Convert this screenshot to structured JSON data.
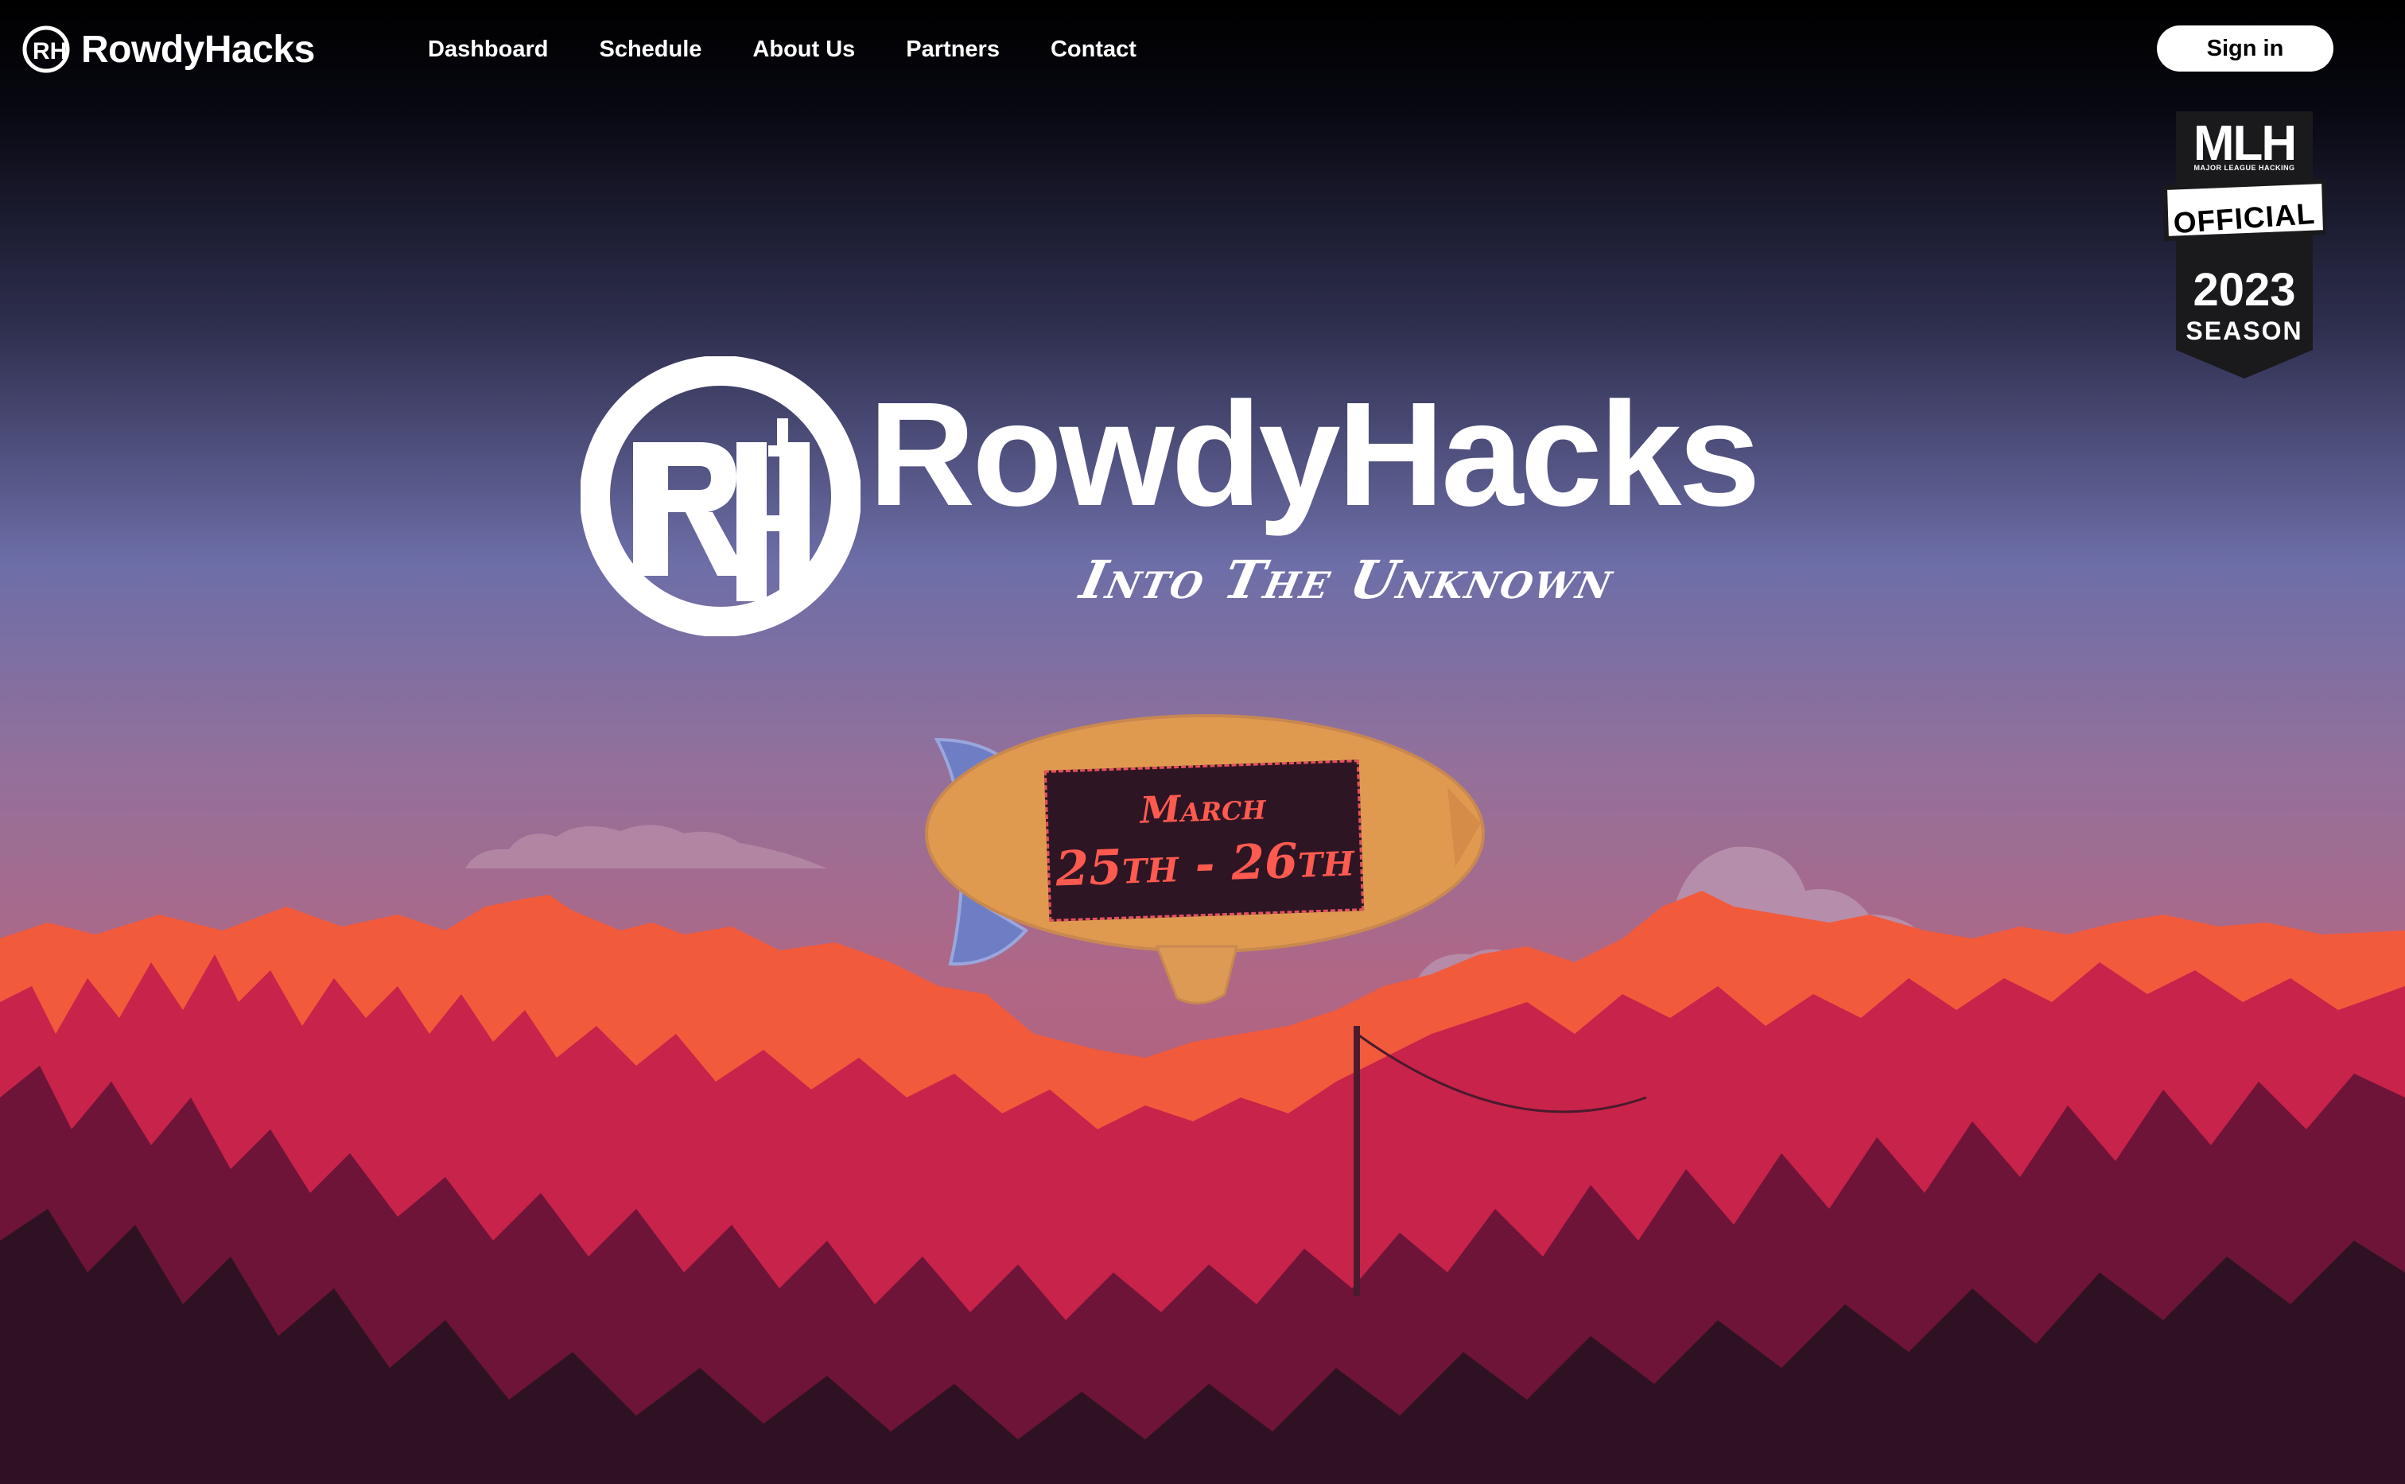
{
  "brand": {
    "name": "RowdyHacks"
  },
  "nav": {
    "links": [
      {
        "label": "Dashboard"
      },
      {
        "label": "Schedule"
      },
      {
        "label": "About Us"
      },
      {
        "label": "Partners"
      },
      {
        "label": "Contact"
      }
    ],
    "signin_label": "Sign in"
  },
  "mlh_badge": {
    "logo": "MLH",
    "subtitle": "MAJOR LEAGUE HACKING",
    "official": "OFFICIAL",
    "year": "2023",
    "season": "SEASON"
  },
  "hero": {
    "title": "RowdyHacks",
    "tagline": "Into The Unknown",
    "logo_icon": "rh-monogram-icon"
  },
  "event": {
    "month": "March",
    "dates": "25th - 26th"
  },
  "colors": {
    "sky_top": "#000000",
    "sky_mid": "#6d6ea8",
    "sky_low": "#b0678a",
    "mountain": "#f25a3c",
    "forest_mid": "#c8234a",
    "forest_dark": "#2e1224",
    "blimp": "#e09a50",
    "blimp_fin": "#6e7ec4",
    "banner_bg": "#2e1524",
    "banner_text": "#ff5a4f"
  }
}
